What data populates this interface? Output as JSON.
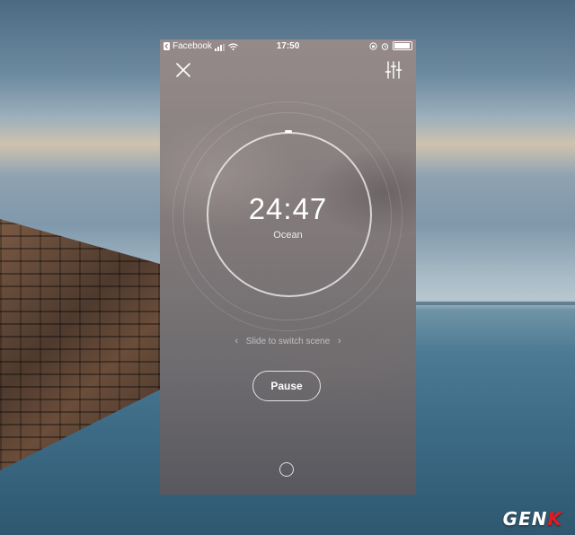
{
  "status_bar": {
    "back_app": "Facebook",
    "time": "17:50"
  },
  "timer": {
    "remaining": "24:47",
    "scene": "Ocean",
    "hint": "Slide to switch scene",
    "pause_label": "Pause"
  },
  "watermark": {
    "prefix": "GEN",
    "suffix": "K"
  },
  "icons": [
    "back-icon",
    "signal-icon",
    "wifi-icon",
    "lock-rotation-icon",
    "alarm-icon",
    "battery-icon",
    "close-icon",
    "equalizer-icon",
    "chevron-left-icon",
    "chevron-right-icon",
    "home-icon"
  ],
  "colors": {
    "accent": "#ffffff",
    "watermark_k": "#e21b22"
  }
}
